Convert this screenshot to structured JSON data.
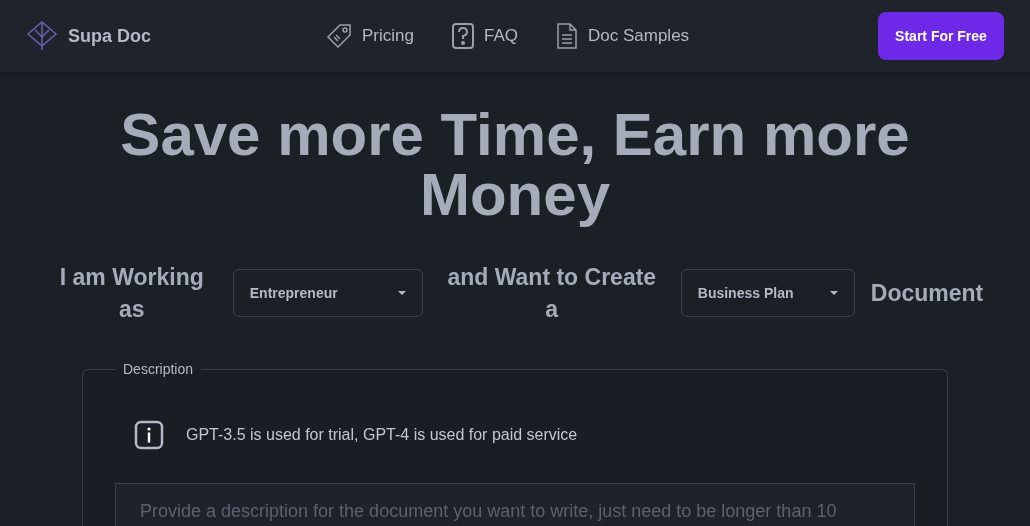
{
  "header": {
    "brand": "Supa Doc",
    "nav": [
      {
        "label": "Pricing"
      },
      {
        "label": "FAQ"
      },
      {
        "label": "Doc Samples"
      }
    ],
    "cta": "Start For Free"
  },
  "headline": "Save more Time, Earn more Money",
  "sentence": {
    "part_1": "I am Working as",
    "role": {
      "value": "Entrepreneur"
    },
    "part_2": "and Want to Create a",
    "document_type": {
      "value": "Business Plan"
    },
    "part_3": "Document"
  },
  "description": {
    "legend": "Description",
    "note": "GPT-3.5 is used for trial, GPT-4 is used for paid service",
    "placeholder": "Provide a description for the document you want to write, just need to be longer than 10"
  }
}
